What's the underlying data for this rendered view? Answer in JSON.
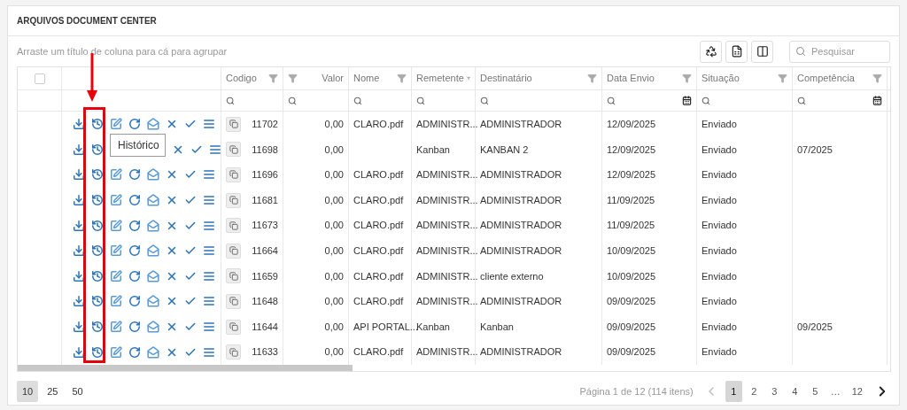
{
  "panel": {
    "title": "ARQUIVOS DOCUMENT CENTER"
  },
  "group_panel": {
    "hint": "Arraste um título de coluna para cá para agrupar"
  },
  "search": {
    "placeholder": "Pesquisar"
  },
  "table": {
    "select_all": {
      "checked": false
    },
    "columns": [
      {
        "label": "Codigo",
        "kind": "text"
      },
      {
        "label": "Valor",
        "kind": "number"
      },
      {
        "label": "Nome",
        "kind": "text"
      },
      {
        "label": "Remetente",
        "kind": "text"
      },
      {
        "label": "Destinatário",
        "kind": "text"
      },
      {
        "label": "Data Envio",
        "kind": "date"
      },
      {
        "label": "Situação",
        "kind": "text"
      },
      {
        "label": "Competência",
        "kind": "date"
      }
    ],
    "rows": [
      {
        "cells": [
          "11702",
          "0,00",
          "CLARO.pdf",
          "ADMINISTR...",
          "ADMINISTRADOR",
          "12/09/2025",
          "Enviado",
          ""
        ]
      },
      {
        "tooltip": "Histórico",
        "cells": [
          "11698",
          "0,00",
          "",
          "Kanban",
          "KANBAN 2",
          "12/09/2025",
          "Enviado",
          "07/2025"
        ]
      },
      {
        "cells": [
          "11696",
          "0,00",
          "CLARO.pdf",
          "ADMINISTR...",
          "ADMINISTRADOR",
          "12/09/2025",
          "Enviado",
          ""
        ]
      },
      {
        "cells": [
          "11681",
          "0,00",
          "CLARO.pdf",
          "ADMINISTR...",
          "ADMINISTRADOR",
          "11/09/2025",
          "Enviado",
          ""
        ]
      },
      {
        "cells": [
          "11673",
          "0,00",
          "CLARO.pdf",
          "ADMINISTR...",
          "ADMINISTRADOR",
          "11/09/2025",
          "Enviado",
          ""
        ]
      },
      {
        "cells": [
          "11664",
          "0,00",
          "CLARO.pdf",
          "ADMINISTR...",
          "ADMINISTRADOR",
          "10/09/2025",
          "Enviado",
          ""
        ]
      },
      {
        "cells": [
          "11659",
          "0,00",
          "CLARO.pdf",
          "ADMINISTR...",
          "cliente externo",
          "10/09/2025",
          "Enviado",
          ""
        ]
      },
      {
        "cells": [
          "11648",
          "0,00",
          "CLARO.pdf",
          "ADMINISTR...",
          "ADMINISTRADOR",
          "09/09/2025",
          "Enviado",
          ""
        ]
      },
      {
        "cells": [
          "11644",
          "0,00",
          "API PORTAL...",
          "Kanban",
          "Kanban",
          "09/09/2025",
          "Enviado",
          "09/2025"
        ]
      },
      {
        "cells": [
          "11633",
          "0,00",
          "CLARO.pdf",
          "ADMINISTR...",
          "ADMINISTRADOR",
          "09/09/2025",
          "Enviado",
          ""
        ]
      }
    ]
  },
  "pager": {
    "sizes": [
      {
        "label": "10",
        "selected": true
      },
      {
        "label": "25",
        "selected": false
      },
      {
        "label": "50",
        "selected": false
      }
    ],
    "info": "Página 1 de 12 (114 itens)",
    "prev_disabled": true,
    "pages": [
      {
        "label": "1",
        "kind": "page",
        "selected": true
      },
      {
        "label": "2",
        "kind": "page",
        "selected": false
      },
      {
        "label": "3",
        "kind": "page",
        "selected": false
      },
      {
        "label": "4",
        "kind": "page",
        "selected": false
      },
      {
        "label": "5",
        "kind": "page",
        "selected": false
      },
      {
        "label": "…",
        "kind": "ellipsis"
      },
      {
        "label": "12",
        "kind": "page",
        "selected": false
      }
    ]
  }
}
